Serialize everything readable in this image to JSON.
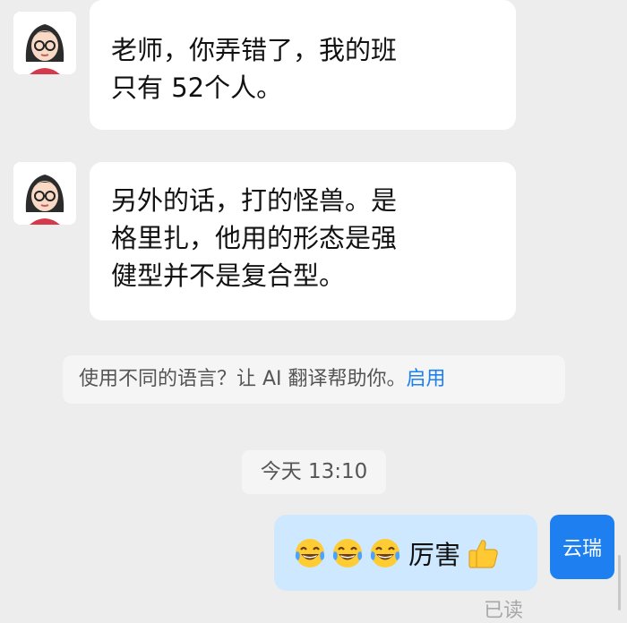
{
  "messages": [
    {
      "sender": "other",
      "lines": [
        "老师，你弄错了，我的班",
        "只有 52个人。"
      ]
    },
    {
      "sender": "other",
      "lines": [
        "另外的话，打的怪兽。是",
        "格里扎，他用的形态是强",
        "健型并不是复合型。"
      ]
    }
  ],
  "notice": {
    "text": "使用不同的语言？让 AI 翻译帮助你。",
    "action": "启用"
  },
  "timestamp": "今天 13:10",
  "my_message": {
    "emoji": "laughing-crying-face",
    "text": "厉害",
    "end_emoji": "thumbs-up",
    "avatar_label": "云瑞",
    "status": "已读"
  },
  "colors": {
    "background": "#ededed",
    "other_bubble": "#ffffff",
    "my_bubble": "#cde8ff",
    "accent": "#1e7ff0",
    "read_status": "#a8a8a8"
  }
}
